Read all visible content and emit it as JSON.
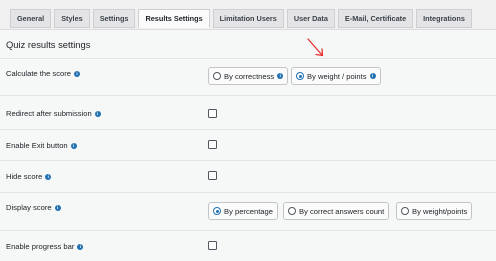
{
  "tabs": [
    {
      "label": "General"
    },
    {
      "label": "Styles"
    },
    {
      "label": "Settings"
    },
    {
      "label": "Results Settings",
      "active": true
    },
    {
      "label": "Limitation Users"
    },
    {
      "label": "User Data"
    },
    {
      "label": "E-Mail, Certificate"
    },
    {
      "label": "Integrations"
    }
  ],
  "section_title": "Quiz results settings",
  "rows": {
    "calculate_score": {
      "label": "Calculate the score",
      "options": [
        {
          "label": "By correctness",
          "checked": false
        },
        {
          "label": "By weight / points",
          "checked": true
        }
      ]
    },
    "redirect": {
      "label": "Redirect after submission",
      "checked": false
    },
    "exit_button": {
      "label": "Enable Exit button",
      "checked": false
    },
    "hide_score": {
      "label": "Hide score",
      "checked": false
    },
    "display_score": {
      "label": "Display score",
      "options": [
        {
          "label": "By percentage",
          "checked": true
        },
        {
          "label": "By correct answers count",
          "checked": false
        },
        {
          "label": "By weight/points",
          "checked": false
        }
      ]
    },
    "progress_bar": {
      "label": "Enable progress bar",
      "checked": false
    }
  },
  "colors": {
    "accent": "#2271b1",
    "annotation_arrow": "#e5322e"
  },
  "icons": {
    "info": "info-circle-icon",
    "annotation": "red-arrow-icon"
  }
}
